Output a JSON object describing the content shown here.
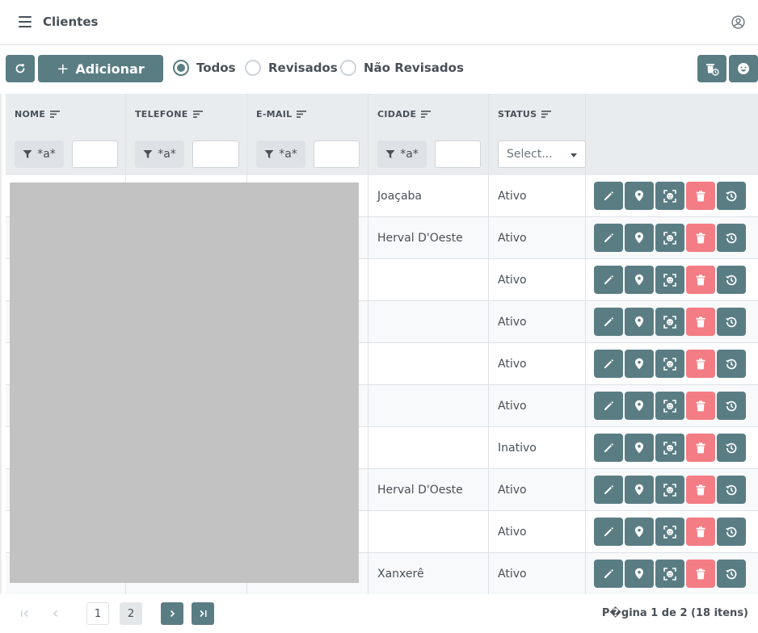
{
  "header": {
    "title": "Clientes"
  },
  "toolbar": {
    "add_label": "Adicionar",
    "filters": [
      {
        "label": "Todos",
        "checked": true
      },
      {
        "label": "Revisados",
        "checked": false
      },
      {
        "label": "Não Revisados",
        "checked": false
      }
    ]
  },
  "table": {
    "columns": [
      "NOME",
      "TELEFONE",
      "E-MAIL",
      "CIDADE",
      "STATUS"
    ],
    "filter_mode_label": "*a*",
    "status_placeholder": "Select...",
    "rows": [
      {
        "cidade": "Joaçaba",
        "status": "Ativo"
      },
      {
        "cidade": "Herval D'Oeste",
        "status": "Ativo"
      },
      {
        "cidade": "",
        "status": "Ativo"
      },
      {
        "cidade": "",
        "status": "Ativo"
      },
      {
        "cidade": "",
        "status": "Ativo"
      },
      {
        "cidade": "",
        "status": "Ativo"
      },
      {
        "cidade": "",
        "status": "Inativo"
      },
      {
        "cidade": "Herval D'Oeste",
        "status": "Ativo"
      },
      {
        "cidade": "",
        "status": "Ativo"
      },
      {
        "cidade": "Xanxerê",
        "status": "Ativo"
      }
    ],
    "row_actions": [
      "pencil-icon",
      "map-marker-icon",
      "face-scan-icon",
      "trash-icon",
      "history-icon"
    ]
  },
  "paginator": {
    "pages": [
      "1",
      "2"
    ],
    "current_page": "2",
    "report": "P�gina 1 de 2 (18 itens)"
  },
  "colors": {
    "primary": "#5a7d84",
    "danger": "#f47c84",
    "header_bg": "#e9ecef"
  }
}
